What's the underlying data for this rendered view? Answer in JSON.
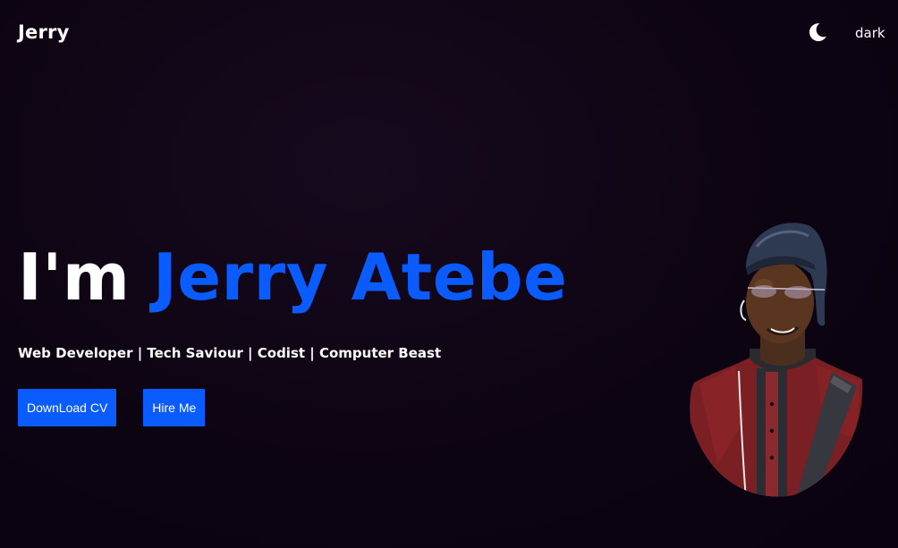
{
  "header": {
    "logo": "Jerry",
    "theme_toggle": {
      "icon": "moon-icon",
      "label": "dark"
    }
  },
  "hero": {
    "headline_prefix": "I'm",
    "headline_name": "Jerry Atebe",
    "tagline": "Web Developer | Tech Saviour | Codist | Computer Beast",
    "buttons": {
      "download_cv": "DownLoad CV",
      "hire_me": "Hire Me"
    },
    "portrait": "profile-photo"
  },
  "colors": {
    "accent": "#0b5cff",
    "background": "#0d0412",
    "text": "#ffffff"
  }
}
